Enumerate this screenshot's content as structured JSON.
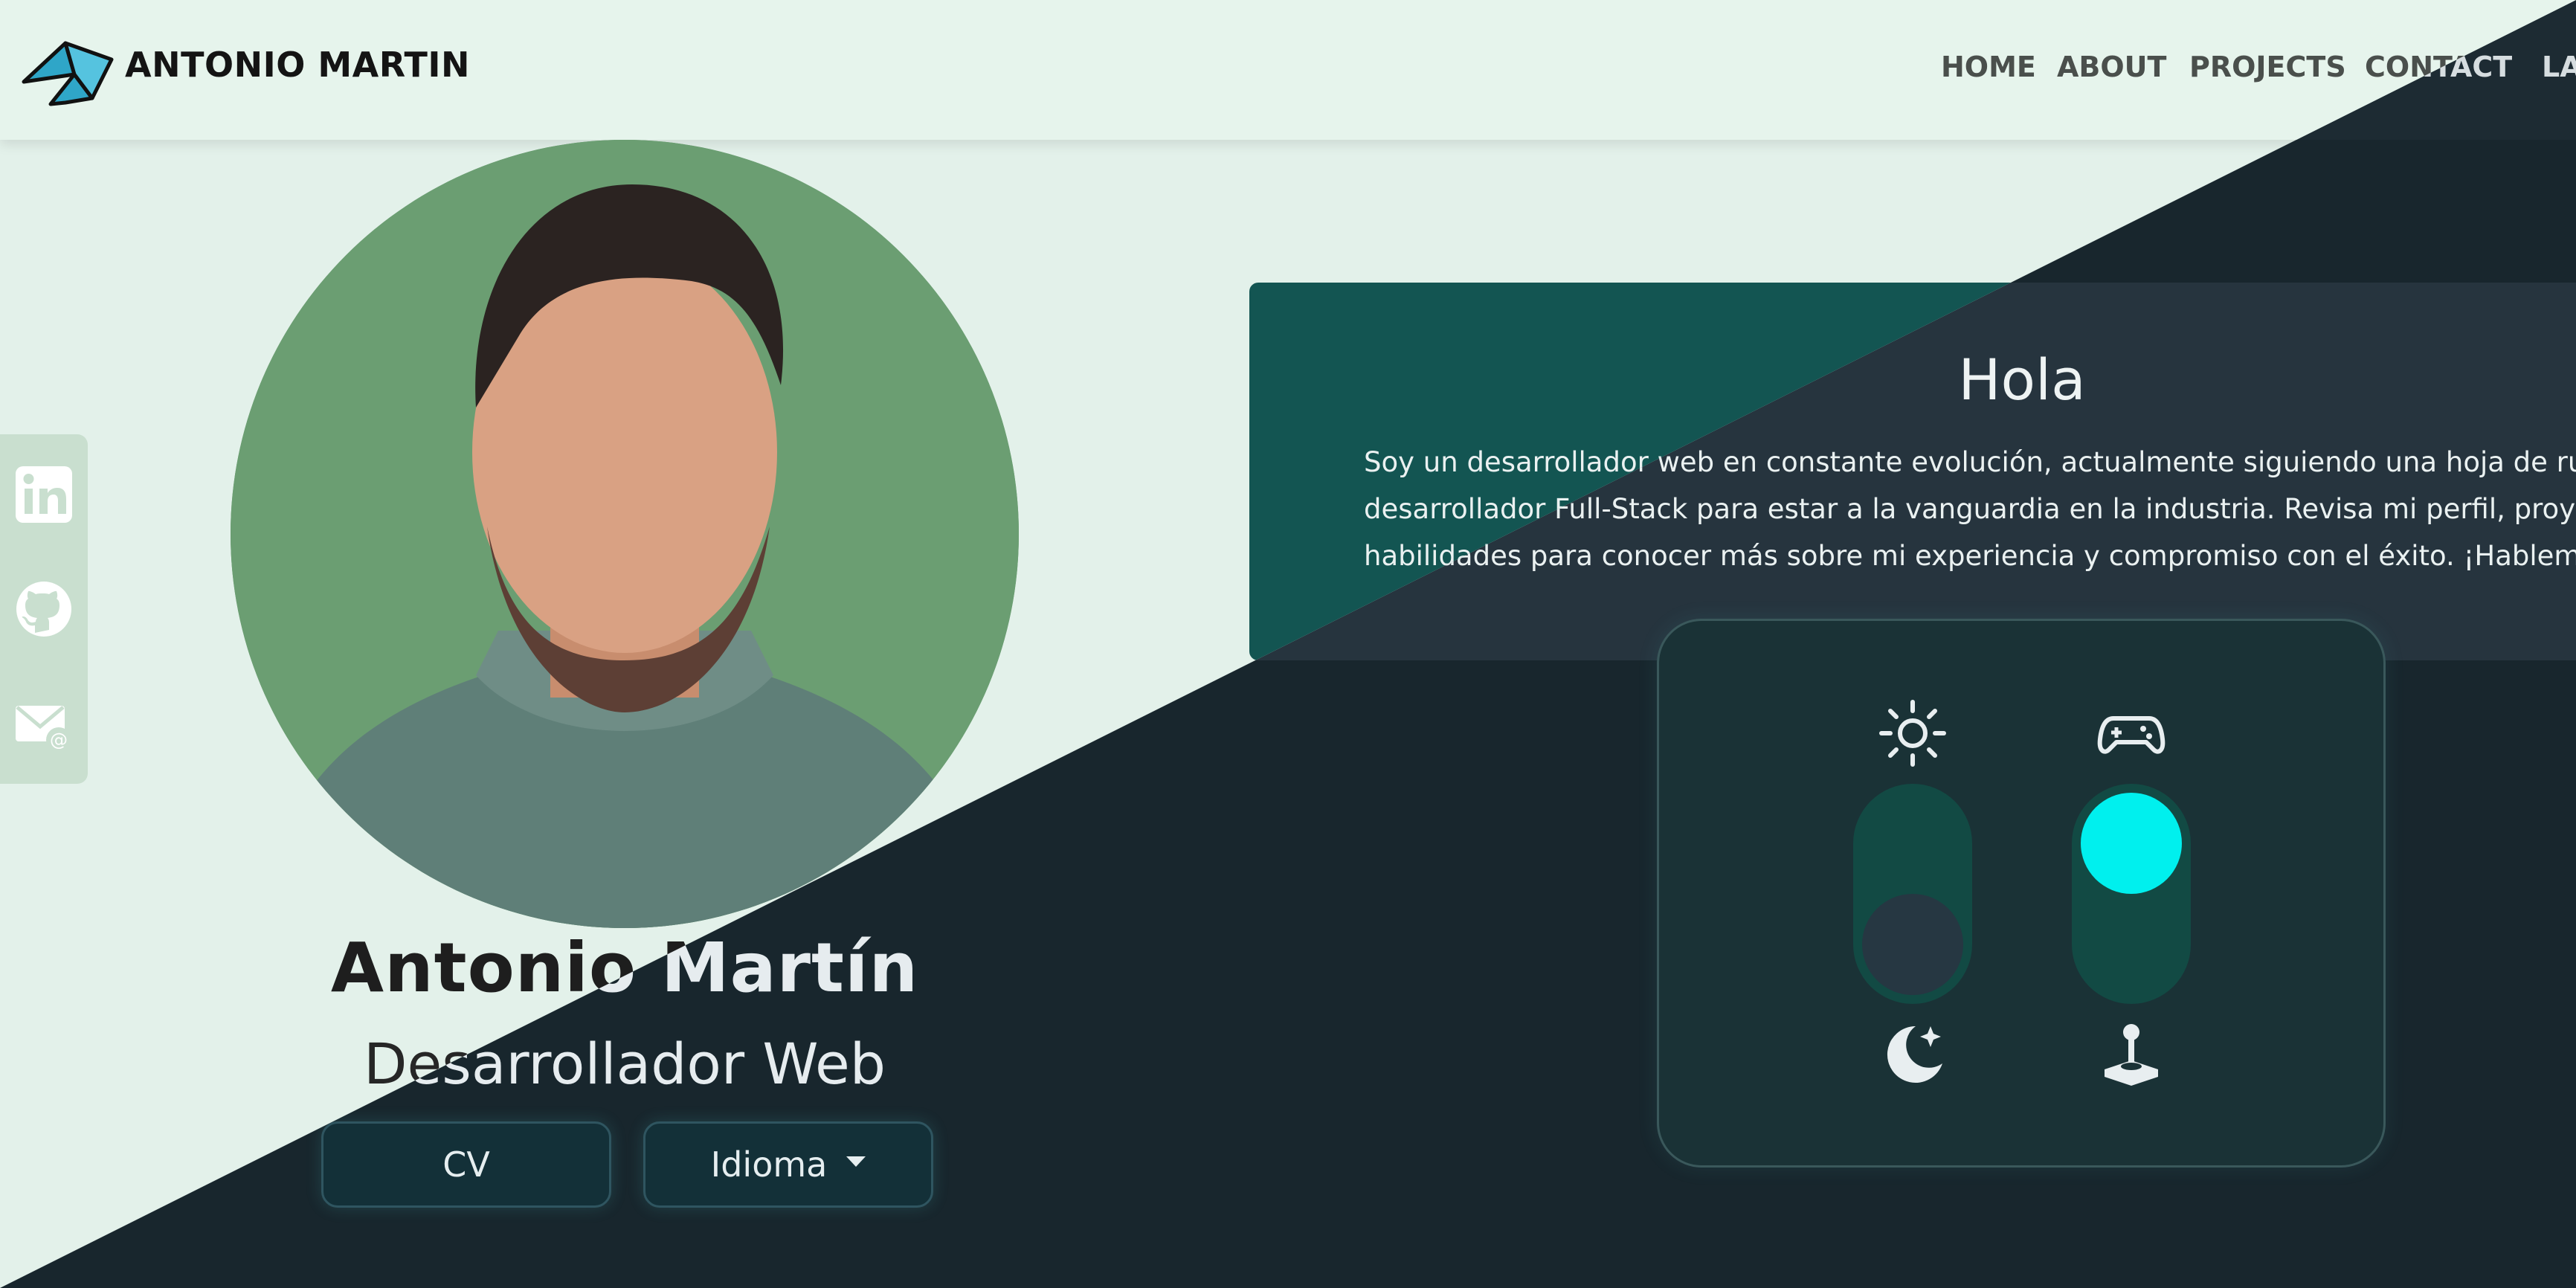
{
  "brand": {
    "name": "ANTONIO MARTIN",
    "logo_icon": "origami-bird-logo"
  },
  "nav": {
    "items": [
      {
        "label": "HOME"
      },
      {
        "label": "ABOUT"
      },
      {
        "label": "PROJECTS"
      },
      {
        "label": "CONTACT"
      },
      {
        "label": "LA"
      }
    ]
  },
  "social": {
    "items": [
      {
        "name": "linkedin-icon",
        "glyph": "in"
      },
      {
        "name": "github-icon"
      },
      {
        "name": "email-icon"
      }
    ]
  },
  "profile": {
    "name": "Antonio Martín",
    "role": "Desarrollador Web",
    "cv_label": "CV",
    "language_label": "Idioma"
  },
  "hola": {
    "title": "Hola",
    "lines": [
      "Soy un desarrollador web en constante evolución, actualmente siguiendo una hoja de ruta de",
      "desarrollador Full-Stack para estar a la vanguardia en la industria. Revisa mi perfil, proyectos y",
      "habilidades para conocer más sobre mi experiencia y compromiso con el éxito. ¡Hablemos!"
    ]
  },
  "toggles": {
    "theme": {
      "top_icon": "sun-icon",
      "bottom_icon": "moon-icon",
      "state": "dark"
    },
    "mode": {
      "top_icon": "gamepad-icon",
      "bottom_icon": "joystick-icon",
      "state": "on"
    }
  },
  "colors": {
    "light_bg": "#e3f1ea",
    "dark_bg": "#18262d",
    "accent_teal": "#135552",
    "toggle_cyan": "#00f0ee"
  }
}
